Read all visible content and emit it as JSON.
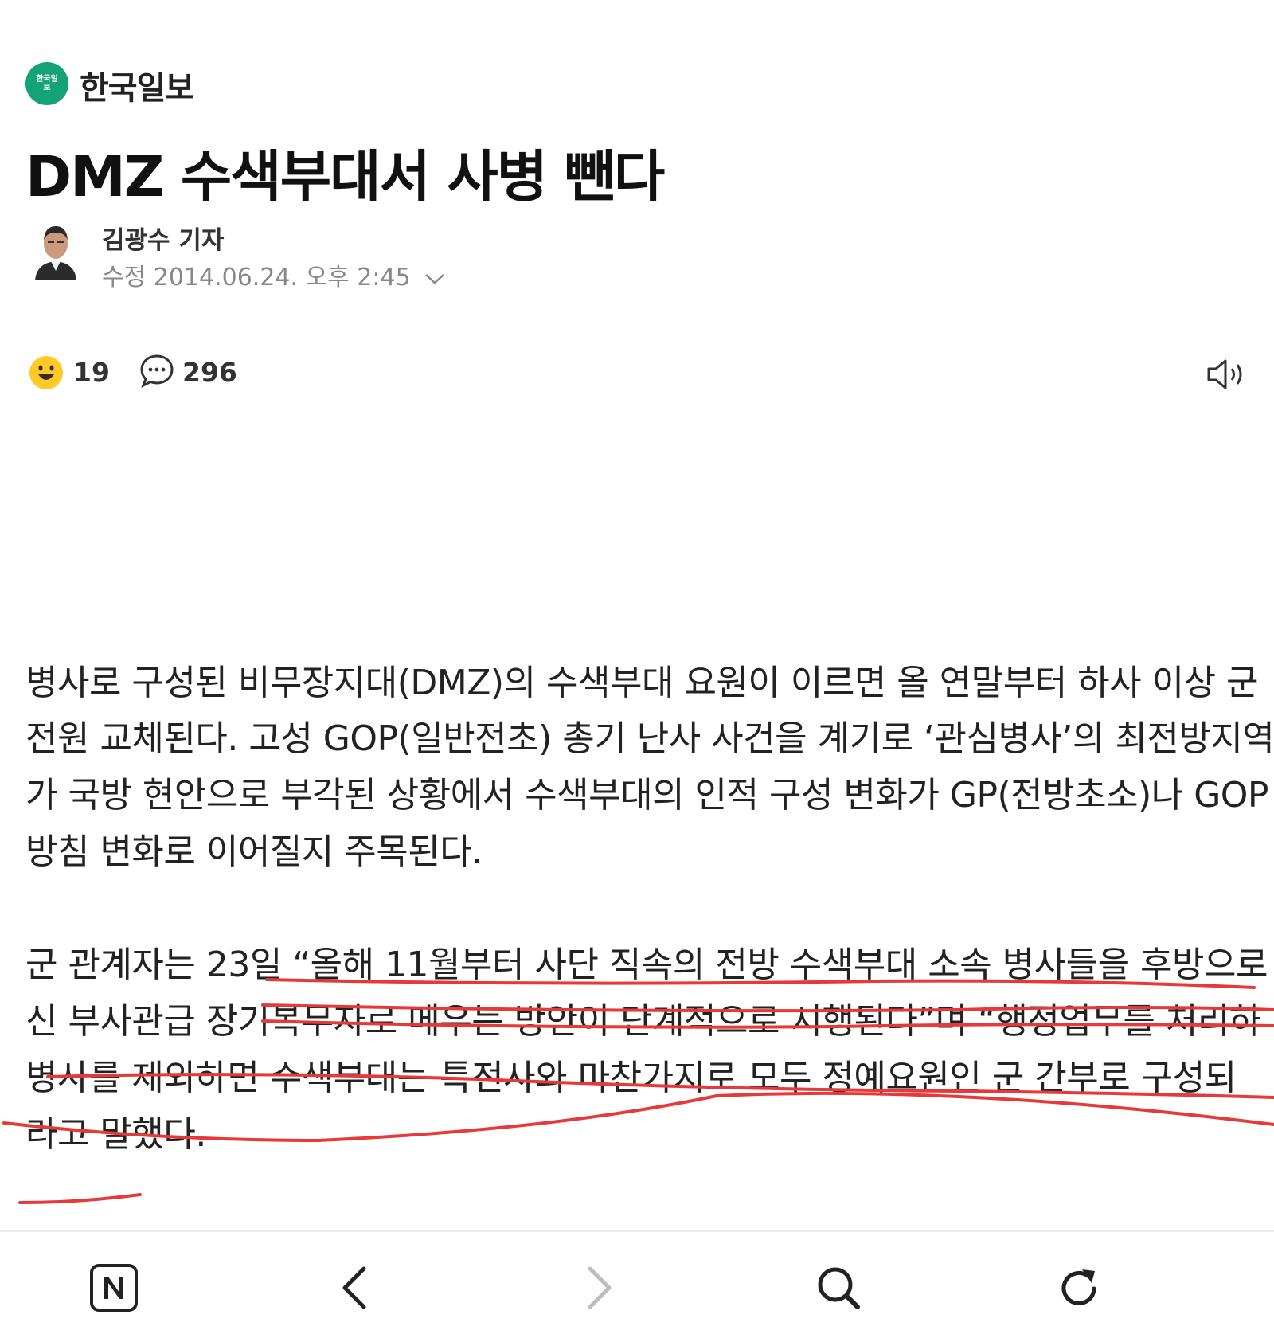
{
  "publisher": {
    "name": "한국일보",
    "logo_text": "한국일보"
  },
  "article": {
    "headline": "DMZ 수색부대서 사병 뺀다",
    "author": "김광수 기자",
    "dateline": "수정 2014.06.24. 오후 2:45",
    "reaction_count": "19",
    "comment_count": "296",
    "body": [
      "병사로 구성된 비무장지대(DMZ)의 수색부대 요원이 이르면 올 연말부터 하사 이상 군",
      "전원 교체된다. 고성 GOP(일반전초) 총기 난사 사건을 계기로 ‘관심병사’의 최전방지역",
      "가 국방 현안으로 부각된 상황에서 수색부대의 인적 구성 변화가 GP(전방초소)나 GOP",
      "방침 변화로 이어질지 주목된다.",
      "",
      "군 관계자는 23일 “올해 11월부터 사단 직속의 전방 수색부대 소속 병사들을 후방으로",
      "신 부사관급 장기복무자로 메우는 방안이 단계적으로 시행된다”며 “행정업무를 처리하",
      "병사를 제외하면 수색부대는 특전사와 마찬가지로 모두 정예요원인 군 간부로 구성되",
      "라고 말했다."
    ]
  },
  "icons": {
    "reaction": "smile-emoji-icon",
    "comment": "comment-bubble-icon",
    "speaker": "speaker-icon",
    "nav": [
      "naver-home-icon",
      "back-chevron-icon",
      "forward-chevron-icon",
      "search-icon",
      "refresh-icon"
    ]
  },
  "colors": {
    "brand": "#14a277",
    "marker": "#e8393a"
  }
}
